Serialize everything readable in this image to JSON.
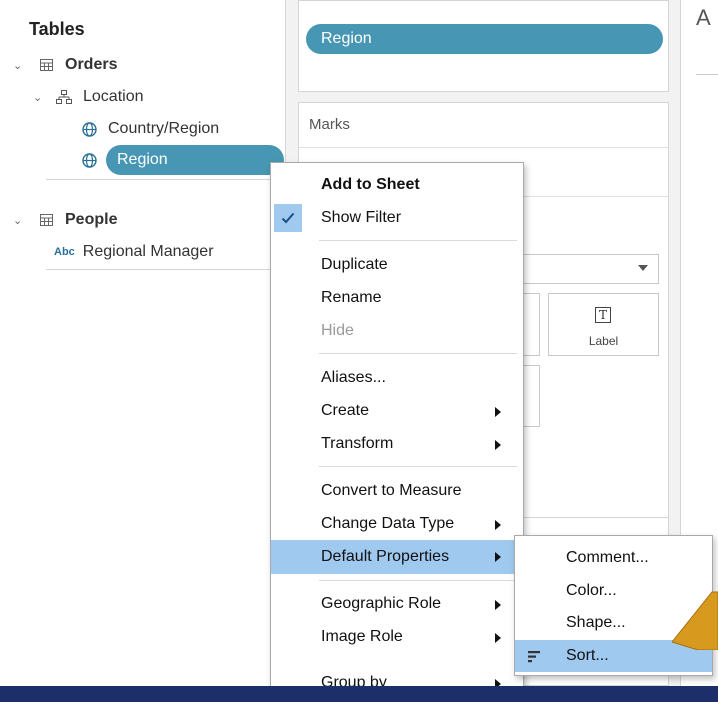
{
  "data_pane": {
    "title": "Tables",
    "orders": "Orders",
    "location": "Location",
    "country_region": "Country/Region",
    "region": "Region",
    "people": "People",
    "abc_badge": "Abc",
    "regional_manager": "Regional Manager"
  },
  "shelves": {
    "filter_pill": "Region",
    "marks_title": "Marks",
    "label_button": "Label"
  },
  "right_header": "A",
  "context_menu": {
    "items": [
      {
        "label": "Add to Sheet"
      },
      {
        "label": "Show Filter"
      },
      {
        "label": "Duplicate"
      },
      {
        "label": "Rename"
      },
      {
        "label": "Hide"
      },
      {
        "label": "Aliases..."
      },
      {
        "label": "Create"
      },
      {
        "label": "Transform"
      },
      {
        "label": "Convert to Measure"
      },
      {
        "label": "Change Data Type"
      },
      {
        "label": "Default Properties"
      },
      {
        "label": "Geographic Role"
      },
      {
        "label": "Image Role"
      },
      {
        "label": "Group by"
      }
    ]
  },
  "submenu": {
    "items": [
      {
        "label": "Comment..."
      },
      {
        "label": "Color..."
      },
      {
        "label": "Shape..."
      },
      {
        "label": "Sort..."
      }
    ]
  },
  "colors": {
    "pill": "#4796b3",
    "highlight": "#9fc9ef",
    "background": "#1c2f6b",
    "arrow": "#d89a1e"
  }
}
